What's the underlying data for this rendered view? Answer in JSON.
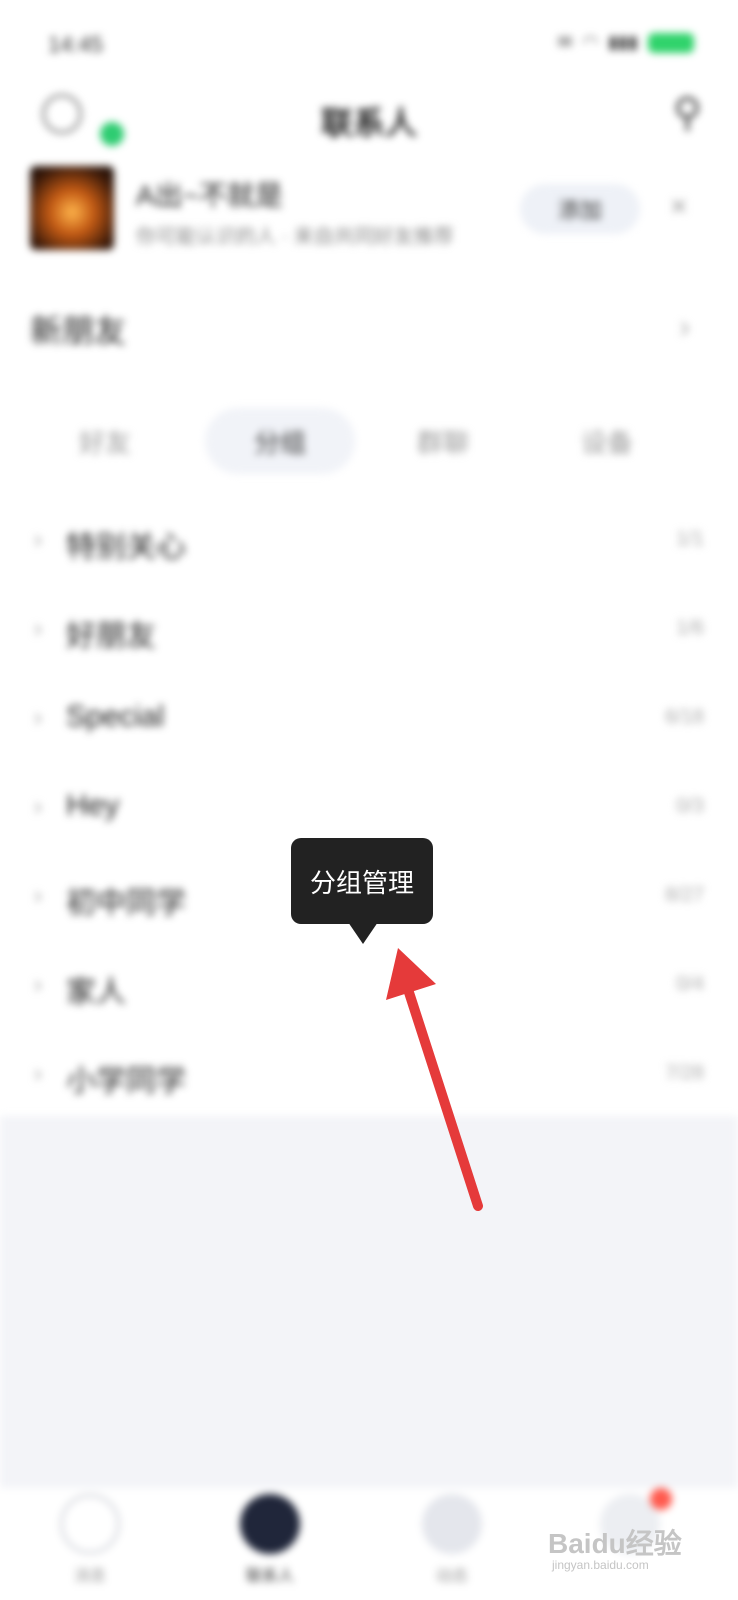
{
  "status_bar": {
    "time": "14:45",
    "icons": [
      "notification-icon",
      "wifi-icon",
      "signal-icon",
      "battery-icon"
    ],
    "battery_color": "#2fd36b"
  },
  "header": {
    "title": "联系人",
    "online_status_color": "#2ecc71"
  },
  "recommendation": {
    "name": "A出~不就是",
    "description": "你可能认识的人 · 来自共同好友推荐",
    "add_label": "添加"
  },
  "new_friends": {
    "label": "新朋友"
  },
  "tabs": [
    {
      "label": "好友",
      "active": false
    },
    {
      "label": "分组",
      "active": true
    },
    {
      "label": "群聊",
      "active": false
    },
    {
      "label": "设备",
      "active": false
    }
  ],
  "groups": [
    {
      "name": "特别关心",
      "count": "1/1"
    },
    {
      "name": "好朋友",
      "count": "1/6"
    },
    {
      "name": "Special",
      "count": "6/18"
    },
    {
      "name": "Hey",
      "count": "0/3"
    },
    {
      "name": "初中同学",
      "count": "8/27"
    },
    {
      "name": "家人",
      "count": "0/4"
    },
    {
      "name": "小学同学",
      "count": "7/28"
    }
  ],
  "tooltip": {
    "label": "分组管理"
  },
  "bottom_nav": [
    {
      "label": "消息",
      "icon": "message-icon"
    },
    {
      "label": "联系人",
      "icon": "contacts-icon"
    },
    {
      "label": "动态",
      "icon": "moments-icon"
    },
    {
      "label": "",
      "icon": "more-icon"
    }
  ],
  "watermark": {
    "text": "Baidu经验",
    "sub": "jingyan.baidu.com"
  },
  "annotation_color": "#e53a3a"
}
